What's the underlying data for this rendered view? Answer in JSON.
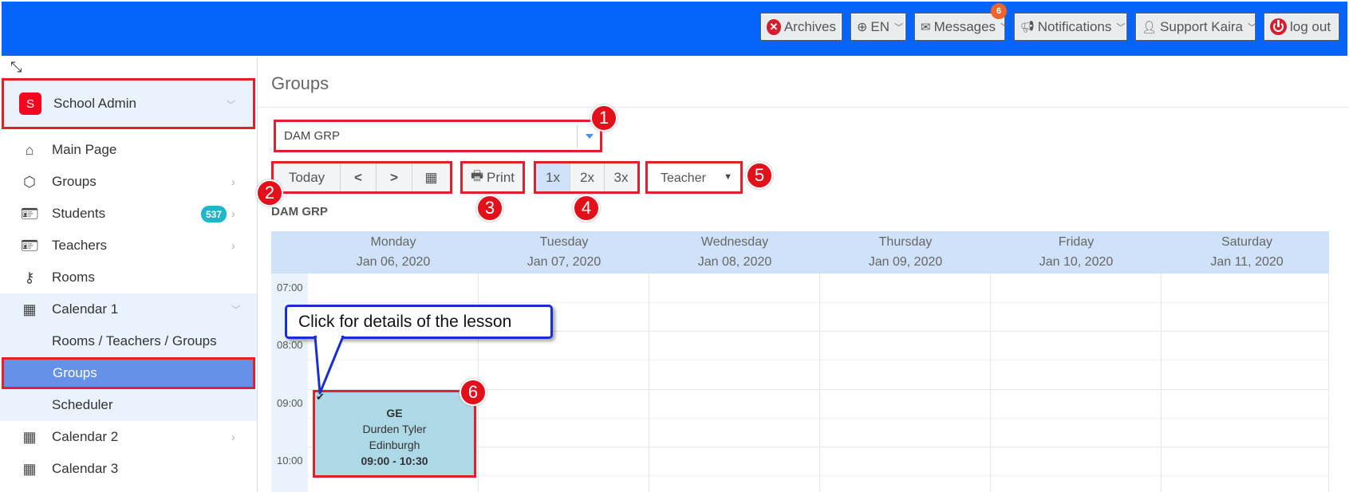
{
  "header": {
    "archives": "Archives",
    "language": "EN",
    "messages": "Messages",
    "messages_badge": "6",
    "notifications": "Notifications",
    "user": "Support Kaira",
    "logout": "log out",
    "bar_color": "#0565fb"
  },
  "sidebar": {
    "account": {
      "initial": "S",
      "label": "School Admin"
    },
    "items": [
      {
        "label": "Main Page",
        "icon": "home-icon"
      },
      {
        "label": "Groups",
        "icon": "cube-icon"
      },
      {
        "label": "Students",
        "icon": "id-card-icon",
        "badge": "537"
      },
      {
        "label": "Teachers",
        "icon": "id-card-icon"
      },
      {
        "label": "Rooms",
        "icon": "key-icon"
      },
      {
        "label": "Calendar 1",
        "icon": "calendar-icon"
      },
      {
        "label": "Rooms / Teachers / Groups"
      },
      {
        "label": "Groups"
      },
      {
        "label": "Scheduler"
      },
      {
        "label": "Calendar 2",
        "icon": "calendar-icon"
      },
      {
        "label": "Calendar 3",
        "icon": "calendar-icon"
      }
    ]
  },
  "main": {
    "title": "Groups",
    "group_select": "DAM GRP",
    "toolbar": {
      "today": "Today",
      "print": "Print",
      "zoom": [
        "1x",
        "2x",
        "3x"
      ],
      "view_select": "Teacher"
    },
    "group_name": "DAM GRP",
    "markers": [
      "1",
      "2",
      "3",
      "4",
      "5",
      "6"
    ],
    "callout": "Click for details of the lesson"
  },
  "calendar": {
    "days": [
      {
        "name": "Monday",
        "date": "Jan 06, 2020"
      },
      {
        "name": "Tuesday",
        "date": "Jan 07, 2020"
      },
      {
        "name": "Wednesday",
        "date": "Jan 08, 2020"
      },
      {
        "name": "Thursday",
        "date": "Jan 09, 2020"
      },
      {
        "name": "Friday",
        "date": "Jan 10, 2020"
      },
      {
        "name": "Saturday",
        "date": "Jan 11, 2020"
      }
    ],
    "times": [
      "07:00",
      "08:00",
      "09:00",
      "10:00"
    ],
    "lesson": {
      "subject": "GE",
      "teacher": "Durden Tyler",
      "location": "Edinburgh",
      "time": "09:00 - 10:30"
    }
  }
}
